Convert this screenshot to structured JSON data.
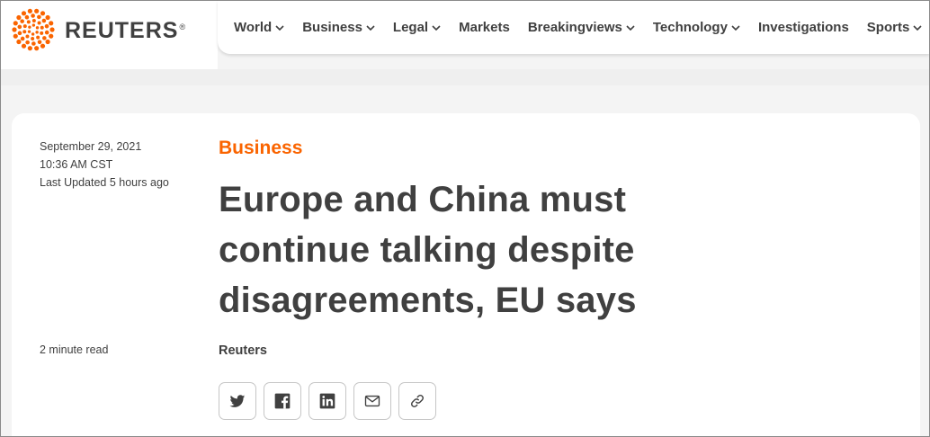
{
  "brand": {
    "name": "REUTERS",
    "reg_mark": "®",
    "accent_color": "#fa6400"
  },
  "nav": {
    "items": [
      {
        "label": "World",
        "has_dropdown": true
      },
      {
        "label": "Business",
        "has_dropdown": true
      },
      {
        "label": "Legal",
        "has_dropdown": true
      },
      {
        "label": "Markets",
        "has_dropdown": false
      },
      {
        "label": "Breakingviews",
        "has_dropdown": true
      },
      {
        "label": "Technology",
        "has_dropdown": true
      },
      {
        "label": "Investigations",
        "has_dropdown": false
      },
      {
        "label": "Sports",
        "has_dropdown": true
      }
    ]
  },
  "article": {
    "date": "September 29, 2021",
    "time": "10:36 AM CST",
    "updated": "Last Updated 5 hours ago",
    "read_time": "2 minute read",
    "section": "Business",
    "headline": "Europe and China must continue talking despite disagreements, EU says",
    "byline": "Reuters"
  },
  "share": {
    "buttons": [
      {
        "name": "twitter-icon"
      },
      {
        "name": "facebook-icon"
      },
      {
        "name": "linkedin-icon"
      },
      {
        "name": "email-icon"
      },
      {
        "name": "link-icon"
      }
    ]
  }
}
